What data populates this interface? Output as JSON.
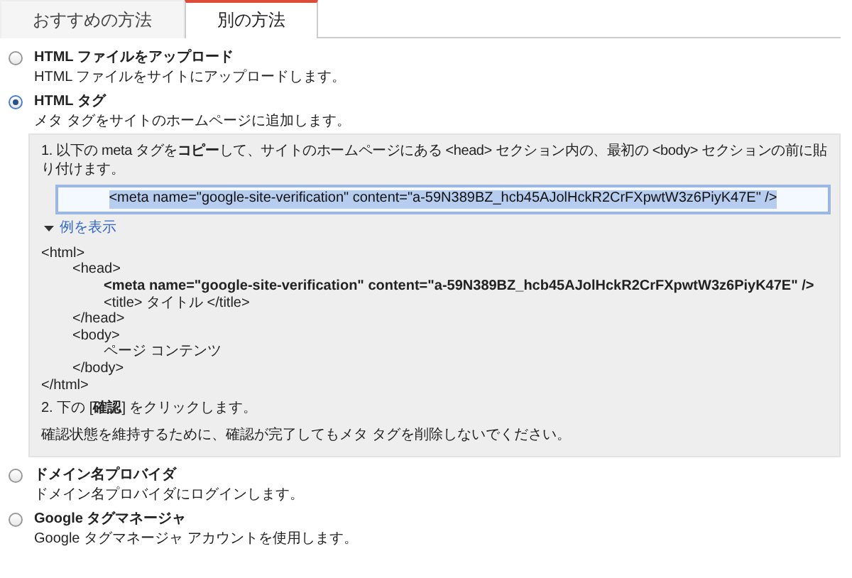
{
  "tabs": [
    {
      "label": "おすすめの方法",
      "selected": false
    },
    {
      "label": "別の方法",
      "selected": true
    }
  ],
  "methods": [
    {
      "title": "HTML ファイルをアップロード",
      "description": "HTML ファイルをサイトにアップロードします。",
      "selected": false
    },
    {
      "title": "HTML タグ",
      "description": "メタ タグをサイトのホームページに追加します。",
      "selected": true,
      "details": {
        "step_1": "1. 以下の meta タグを**コピー**して、サイトのホームページにある <head> セクション内の、最初の <body> セクションの前に貼り付けます。",
        "meta_tag": "<meta name=\"google-site-verification\" content=\"a-59N389BZ_hcb45AJolHckR2CrFXpwtW3z6PiyK47E\" />",
        "meta_tag_selected": true,
        "example_toggle": {
          "label": "例を表示",
          "expanded": true
        },
        "example_code": [
          {
            "text": "<html>",
            "emphasis": false,
            "children": [
              {
                "text": "<head>",
                "emphasis": false,
                "children": [
                  {
                    "text": "<meta name=\"google-site-verification\" content=\"a-59N389BZ_hcb45AJolHckR2CrFXpwtW3z6PiyK47E\" />",
                    "emphasis": true
                  },
                  {
                    "text": "<title> タイトル </title>",
                    "emphasis": false
                  }
                ]
              },
              {
                "text": "</head>",
                "emphasis": false
              },
              {
                "text": "<body>",
                "emphasis": false,
                "children": [
                  {
                    "text": "ページ コンテンツ",
                    "emphasis": false
                  }
                ]
              },
              {
                "text": "</body>",
                "emphasis": false
              }
            ]
          },
          {
            "text": "</html>",
            "emphasis": false
          }
        ],
        "step_2": "2. 下の [**確認**] をクリックします。",
        "note": "確認状態を維持するために、確認が完了してもメタ タグを削除しないでください。"
      }
    },
    {
      "title": "ドメイン名プロバイダ",
      "description": "ドメイン名プロバイダにログインします。",
      "selected": false
    },
    {
      "title": "Google タグマネージャ",
      "description": "Google タグマネージャ アカウントを使用します。",
      "selected": false
    }
  ]
}
